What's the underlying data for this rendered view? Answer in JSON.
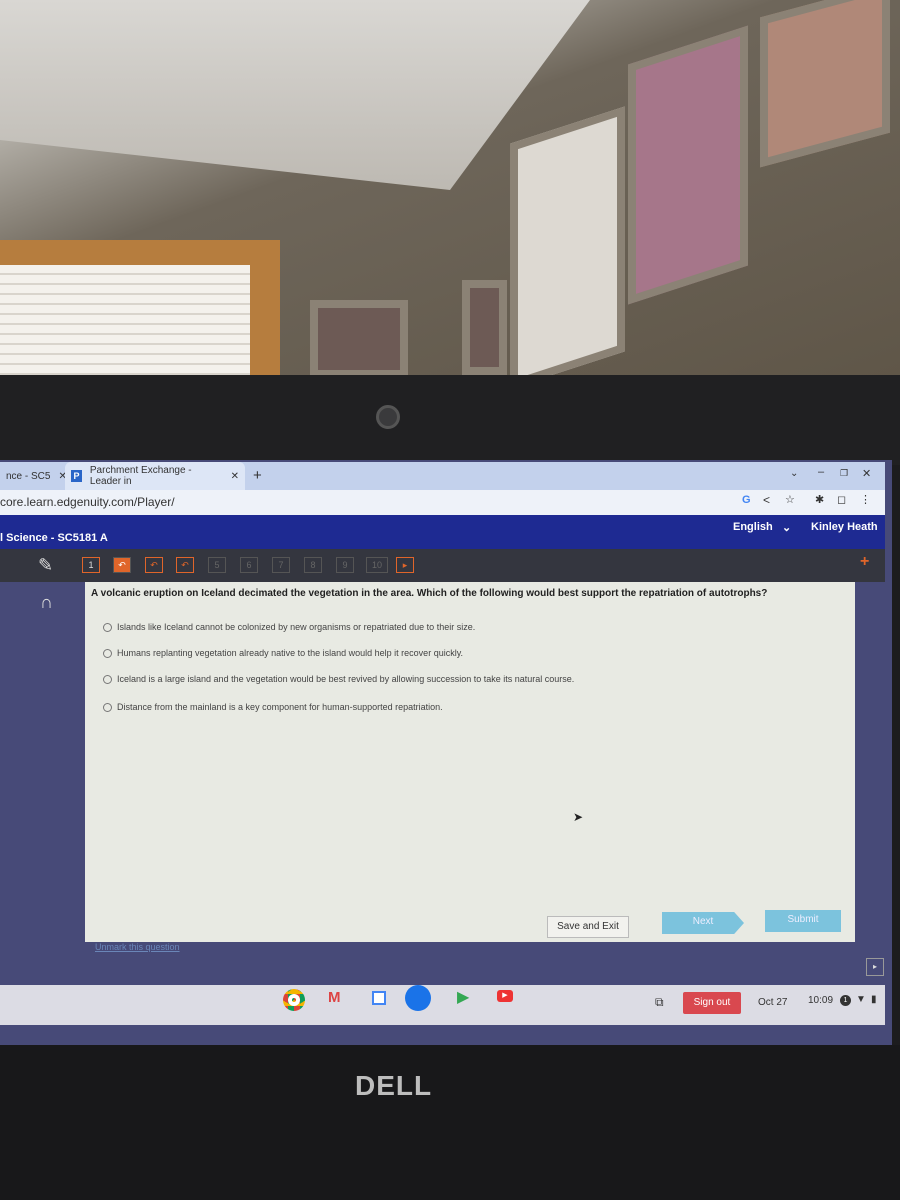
{
  "browser": {
    "tabs": [
      {
        "label": "nce - SC5"
      },
      {
        "label": "Parchment Exchange - Leader in"
      }
    ],
    "new_tab": "+",
    "url": "core.learn.edgenuity.com/Player/"
  },
  "header": {
    "course": "l Science - SC5181 A",
    "language": "English",
    "user": "Kinley Heath"
  },
  "toolbar": {
    "questions": [
      "1",
      "",
      "",
      "",
      "5",
      "6",
      "7",
      "8",
      "9",
      "10"
    ]
  },
  "question": {
    "text": "A volcanic eruption on Iceland decimated the vegetation in the area. Which of the following would best support the repatriation of autotrophs?",
    "options": [
      "Islands like Iceland cannot be colonized by new organisms or repatriated due to their size.",
      "Humans replanting vegetation already native to the island would help it recover quickly.",
      "Iceland is a large island and the vegetation would be best revived by allowing succession to take its natural course.",
      "Distance from the mainland is a key component for human-supported repatriation."
    ]
  },
  "actions": {
    "unmark": "Unmark this question",
    "save_exit": "Save and Exit",
    "next": "Next",
    "submit": "Submit"
  },
  "taskbar": {
    "sign_out": "Sign out",
    "date": "Oct 27",
    "time": "10:09",
    "notifications": "1"
  },
  "logo": "DELL",
  "colors": {
    "header": "#1e2a92",
    "accent": "#e0652a",
    "next": "#7cc3dd",
    "sign_out": "#d9484f"
  }
}
